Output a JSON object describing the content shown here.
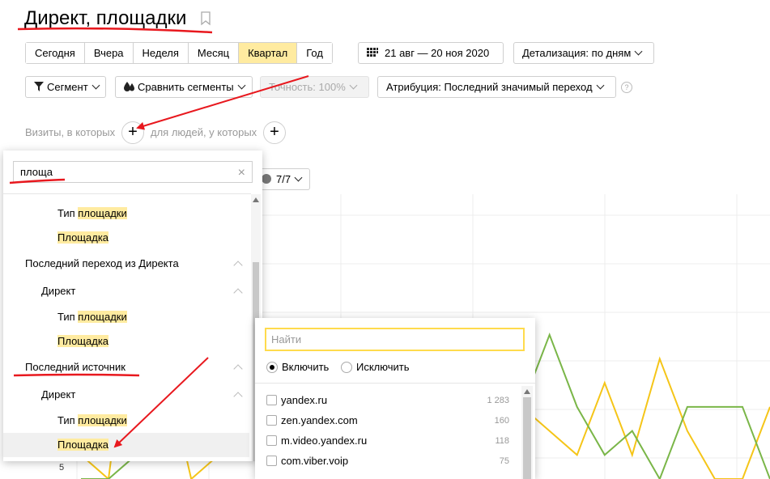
{
  "page": {
    "title": "Директ, площадки"
  },
  "period": {
    "tabs": [
      {
        "label": "Сегодня",
        "active": false
      },
      {
        "label": "Вчера",
        "active": false
      },
      {
        "label": "Неделя",
        "active": false
      },
      {
        "label": "Месяц",
        "active": false
      },
      {
        "label": "Квартал",
        "active": true
      },
      {
        "label": "Год",
        "active": false
      }
    ],
    "date_range": "21 авг — 20 ноя 2020",
    "detail": "Детализация: по дням"
  },
  "toolbar": {
    "segment": "Сегмент",
    "compare": "Сравнить сегменты",
    "accuracy": "Точность: 100%",
    "attribution": "Атрибуция: Последний значимый переход",
    "help": "?"
  },
  "filters": {
    "visits_label": "Визиты, в которых",
    "people_label": "для людей, у которых",
    "plus": "+"
  },
  "chart_controls": {
    "series_count": "7/7",
    "y_tick_label": "5"
  },
  "left_panel": {
    "search_value": "площа",
    "clear": "×",
    "rows": [
      {
        "pre": "Тип ",
        "hl": "площадки",
        "post": ""
      },
      {
        "pre": "",
        "hl": "Площадка",
        "post": ""
      },
      {
        "pre": "Последний переход из Директа",
        "hl": "",
        "post": ""
      },
      {
        "pre": "Директ",
        "hl": "",
        "post": ""
      },
      {
        "pre": "Тип ",
        "hl": "площадки",
        "post": ""
      },
      {
        "pre": "",
        "hl": "Площадка",
        "post": ""
      },
      {
        "pre": "Последний источник",
        "hl": "",
        "post": ""
      },
      {
        "pre": "Директ",
        "hl": "",
        "post": ""
      },
      {
        "pre": "Тип ",
        "hl": "площадки",
        "post": ""
      },
      {
        "pre": "",
        "hl": "Площадка",
        "post": ""
      }
    ]
  },
  "right_panel": {
    "find_placeholder": "Найти",
    "include": "Включить",
    "exclude": "Исключить",
    "options": [
      {
        "label": "yandex.ru",
        "count": "1 283"
      },
      {
        "label": "zen.yandex.com",
        "count": "160"
      },
      {
        "label": "m.video.yandex.ru",
        "count": "118"
      },
      {
        "label": "com.viber.voip",
        "count": "75"
      }
    ]
  },
  "chart_data": {
    "type": "line",
    "title": "",
    "xlabel": "",
    "ylabel": "",
    "series": [
      {
        "color": "#f5c518",
        "values": [
          1,
          0,
          9,
          5,
          0,
          1,
          1,
          3,
          0,
          1,
          4,
          3,
          6,
          0,
          2,
          6,
          3,
          2,
          1,
          4,
          1,
          5,
          2,
          0,
          0,
          3
        ]
      },
      {
        "color": "#7ab648",
        "values": [
          0,
          0,
          1,
          3,
          8,
          6,
          2,
          6,
          4,
          1,
          3,
          1,
          2,
          1,
          3,
          1,
          3,
          6,
          3,
          1,
          2,
          0,
          3,
          3,
          3,
          0
        ]
      }
    ],
    "colors": {
      "accent_yellow": "#ffeba0",
      "annotation_red": "#e8181e",
      "line_yellow": "#f5c518",
      "line_green": "#7ab648"
    }
  }
}
